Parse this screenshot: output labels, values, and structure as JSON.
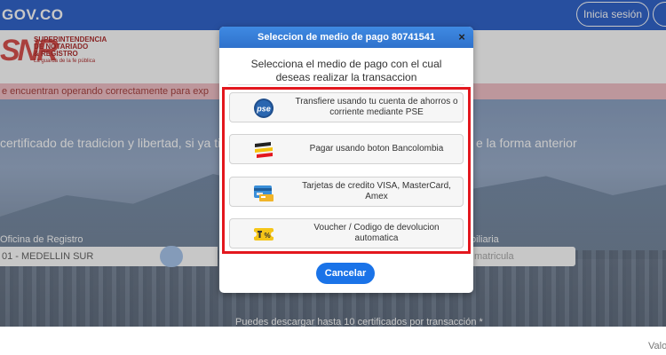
{
  "header": {
    "brand": "GOV.CO",
    "login_label": "Inicia sesión"
  },
  "logo": {
    "letters": "SNR",
    "line1": "SUPERINTENDENCIA",
    "line2": "DE NOTARIADO",
    "line3": "& REGISTRO",
    "tagline": "La guarda de la fe pública"
  },
  "alert": {
    "text": "e encuentran operando correctamente para exp"
  },
  "hero": {
    "text_left": "certificado de tradicion y libertad, si ya tien",
    "text_right": "e la forma anterior"
  },
  "form": {
    "oficina_label": "Oficina de Registro",
    "oficina_value": "01 - MEDELLIN SUR",
    "matricula_label": "biliaria",
    "matricula_placeholder": "matricula"
  },
  "footer_note": "Puedes descargar hasta 10 certificados por transacción *",
  "bottom_right_text": "Valo",
  "modal": {
    "title": "Seleccion de medio de pago 80741541",
    "close_symbol": "×",
    "intro": "Selecciona el medio de pago con el cual deseas realizar la transaccion",
    "options": [
      {
        "icon": "pse-logo-icon",
        "label": "Transfiere usando tu cuenta de ahorros o corriente mediante PSE"
      },
      {
        "icon": "bancolombia-logo-icon",
        "label": "Pagar usando boton Bancolombia"
      },
      {
        "icon": "credit-card-icon",
        "label": "Tarjetas de credito VISA, MasterCard, Amex"
      },
      {
        "icon": "voucher-icon",
        "label": "Voucher / Codigo de devolucion automatica"
      }
    ],
    "cancel_label": "Cancelar"
  },
  "colors": {
    "header_blue": "#3366cc",
    "modal_header": "#2f72cc",
    "highlight_red": "#e3171e",
    "cancel_blue": "#1a73e8"
  }
}
